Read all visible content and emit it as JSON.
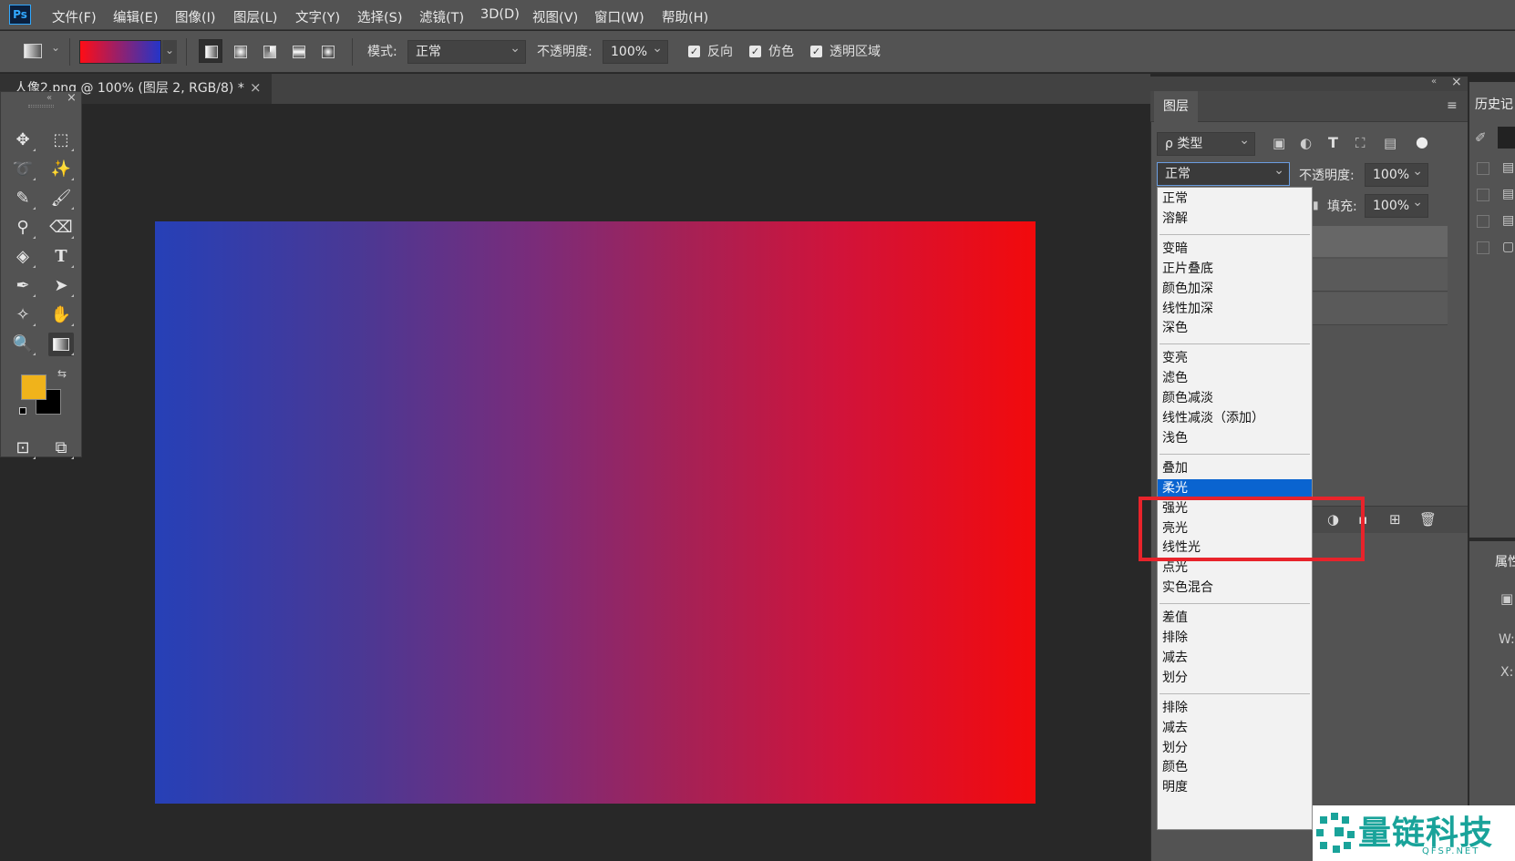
{
  "app": {
    "logo": "Ps"
  },
  "menubar": {
    "items": [
      "文件(F)",
      "编辑(E)",
      "图像(I)",
      "图层(L)",
      "文字(Y)",
      "选择(S)",
      "滤镜(T)",
      "3D(D)",
      "视图(V)",
      "窗口(W)",
      "帮助(H)"
    ]
  },
  "options": {
    "mode_label": "模式:",
    "mode_value": "正常",
    "opacity_label": "不透明度:",
    "opacity_value": "100%",
    "reverse_label": "反向",
    "dither_label": "仿色",
    "transparency_label": "透明区域",
    "gradient_colors": [
      "#ff0d16",
      "#2435c8"
    ]
  },
  "document": {
    "tab_title": "人像2.png @ 100% (图层 2, RGB/8) *",
    "gradient_colors": [
      "#2640b7",
      "#f20a0c"
    ]
  },
  "toolbar": {
    "foreground_color": "#f0b31b",
    "background_color": "#000000"
  },
  "layers_panel": {
    "tab_label": "图层",
    "filter_label": "ρ 类型",
    "blend_mode": "正常",
    "opacity_label": "不透明度:",
    "opacity_value": "100%",
    "fill_label": "填充:",
    "fill_value": "100%"
  },
  "blend_modes": {
    "groups": [
      [
        "正常",
        "溶解"
      ],
      [
        "变暗",
        "正片叠底",
        "颜色加深",
        "线性加深",
        "深色"
      ],
      [
        "变亮",
        "滤色",
        "颜色减淡",
        "线性减淡（添加）",
        "浅色"
      ],
      [
        "叠加",
        "柔光",
        "强光",
        "亮光",
        "线性光",
        "点光",
        "实色混合"
      ],
      [
        "差值",
        "排除",
        "减去",
        "划分"
      ],
      [
        "排除",
        "减去",
        "划分",
        "颜色",
        "明度"
      ]
    ],
    "highlighted": "柔光"
  },
  "history_panel": {
    "tab_label": "历史记"
  },
  "properties_panel": {
    "tab_label": "属性",
    "w_label": "W:",
    "x_label": "X:"
  },
  "watermark": {
    "text": "量链科技",
    "sub": "QFSP.NET"
  }
}
